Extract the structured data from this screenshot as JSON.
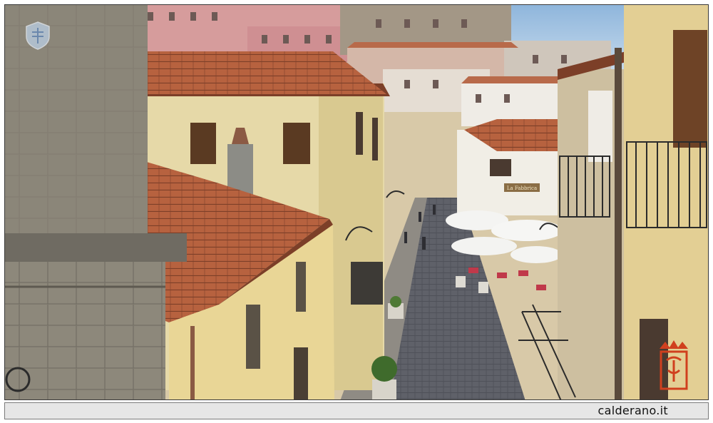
{
  "caption": {
    "text": "calderano.it"
  },
  "badges": {
    "top_left": "crest-watermark-icon",
    "bottom_right": "logo-watermark-icon"
  },
  "shop_signs": {
    "sign_1": "La Fabbrica"
  },
  "colors": {
    "roof_terracotta": "#b5623f",
    "wall_cream": "#e6d9a8",
    "stone_grey": "#8a8578",
    "sky": "#b9d4ea",
    "street": "#5d5f66",
    "umbrella": "#f4f4f2",
    "caption_bg": "#e6e6e6",
    "logo_red": "#d0401e"
  }
}
